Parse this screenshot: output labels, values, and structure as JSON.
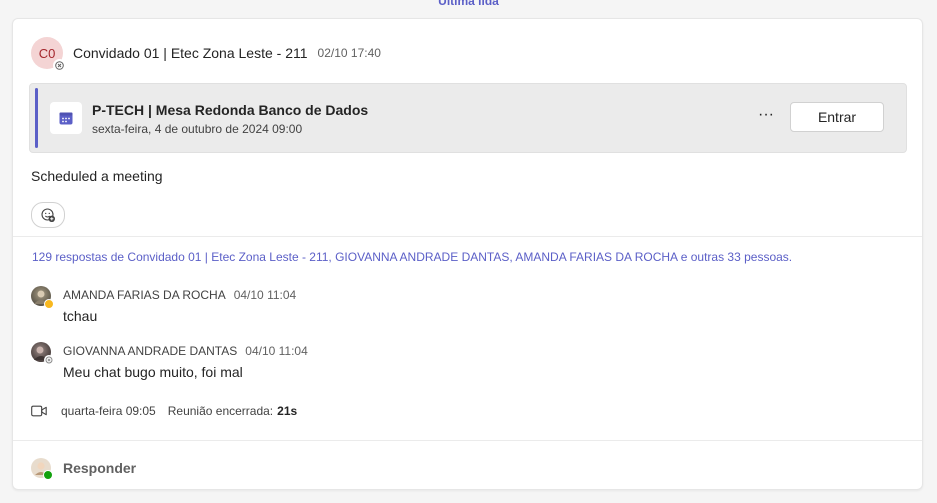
{
  "top_link": "Última lida",
  "post": {
    "avatar_initials": "C0",
    "author": "Convidado 01 | Etec Zona Leste - 211",
    "time": "02/10 17:40"
  },
  "meeting": {
    "title": "P-TECH | Mesa Redonda Banco de Dados",
    "date": "sexta-feira, 4 de outubro de 2024 09:00",
    "more": "···",
    "join_label": "Entrar"
  },
  "scheduled_text": "Scheduled a meeting",
  "replies_summary": "129 respostas de Convidado 01 | Etec Zona Leste - 211, GIOVANNA ANDRADE DANTAS, AMANDA FARIAS DA ROCHA e outras 33 pessoas.",
  "replies": [
    {
      "name": "AMANDA FARIAS DA ROCHA",
      "time": "04/10 11:04",
      "text": "tchau"
    },
    {
      "name": "GIOVANNA ANDRADE DANTAS",
      "time": "04/10 11:04",
      "text": "Meu chat bugo muito, foi mal"
    }
  ],
  "meeting_ended": {
    "time": "quarta-feira 09:05",
    "label": "Reunião encerrada:",
    "duration": "21s"
  },
  "reply_bar": {
    "label": "Responder"
  },
  "colors": {
    "accent": "#5b5fc7",
    "available": "#13a10e",
    "away": "#f8b81f"
  }
}
